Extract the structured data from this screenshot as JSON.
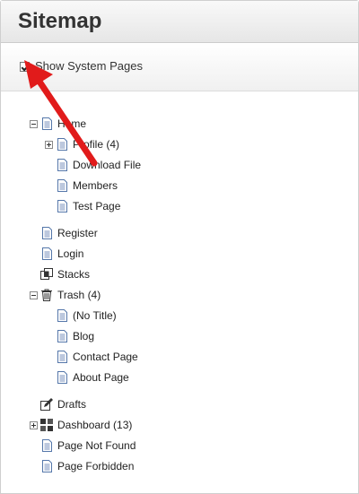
{
  "header": {
    "title": "Sitemap"
  },
  "options": {
    "show_system_pages_label": "Show System Pages",
    "show_system_pages_checked": true
  },
  "tree": {
    "home": "Home",
    "profile": "Profile (4)",
    "download_file": "Download File",
    "members": "Members",
    "test_page": "Test Page",
    "register": "Register",
    "login": "Login",
    "stacks": "Stacks",
    "trash": "Trash (4)",
    "no_title": "(No Title)",
    "blog": "Blog",
    "contact_page": "Contact Page",
    "about_page": "About Page",
    "drafts": "Drafts",
    "dashboard": "Dashboard (13)",
    "page_not_found": "Page Not Found",
    "page_forbidden": "Page Forbidden"
  },
  "colors": {
    "annotation_arrow": "#e11b1b",
    "icon_blue": "#5577aa"
  }
}
